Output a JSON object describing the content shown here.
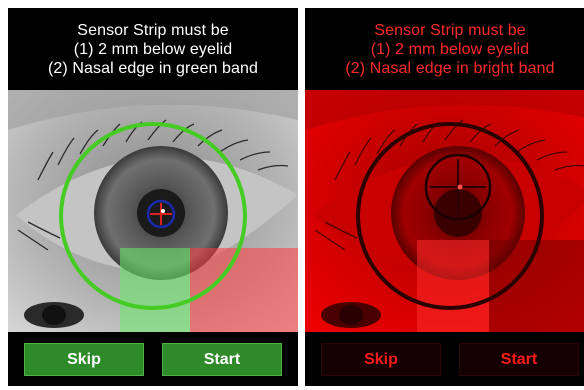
{
  "left_panel": {
    "instructions": [
      "Sensor Strip must be",
      "(1) 2 mm below eyelid",
      "(2) Nasal edge in green band"
    ],
    "skip_label": "Skip",
    "start_label": "Start",
    "guide_color": "#44cc22",
    "band_color": "#66ee66",
    "marker_color": "#1a2aa8",
    "crosshair_color": "#dd2222"
  },
  "right_panel": {
    "instructions": [
      "Sensor Strip must be",
      "(1) 2 mm below eyelid",
      "(2) Nasal edge in bright band"
    ],
    "skip_label": "Skip",
    "start_label": "Start",
    "tint_color": "#ff0000"
  }
}
